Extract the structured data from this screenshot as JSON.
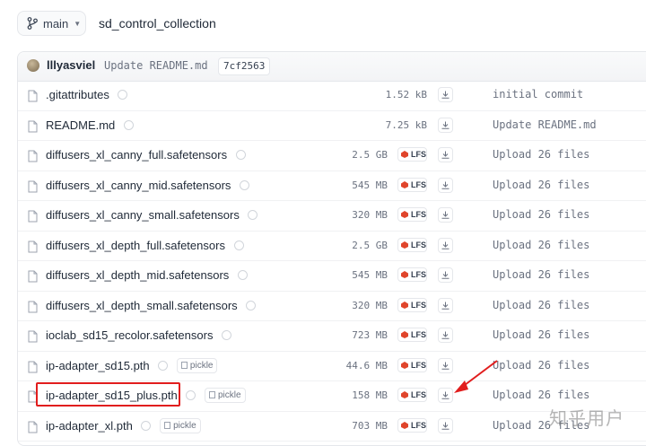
{
  "header": {
    "branch_label": "main",
    "repo_name": "sd_control_collection"
  },
  "commit": {
    "user": "lllyasviel",
    "message": "Update README.md",
    "hash": "7cf2563"
  },
  "files": [
    {
      "name": ".gitattributes",
      "size": "1.52 kB",
      "lfs": false,
      "pickle": false,
      "commit": "initial commit"
    },
    {
      "name": "README.md",
      "size": "7.25 kB",
      "lfs": false,
      "pickle": false,
      "commit": "Update README.md"
    },
    {
      "name": "diffusers_xl_canny_full.safetensors",
      "size": "2.5 GB",
      "lfs": true,
      "pickle": false,
      "commit": "Upload 26 files"
    },
    {
      "name": "diffusers_xl_canny_mid.safetensors",
      "size": "545 MB",
      "lfs": true,
      "pickle": false,
      "commit": "Upload 26 files"
    },
    {
      "name": "diffusers_xl_canny_small.safetensors",
      "size": "320 MB",
      "lfs": true,
      "pickle": false,
      "commit": "Upload 26 files"
    },
    {
      "name": "diffusers_xl_depth_full.safetensors",
      "size": "2.5 GB",
      "lfs": true,
      "pickle": false,
      "commit": "Upload 26 files"
    },
    {
      "name": "diffusers_xl_depth_mid.safetensors",
      "size": "545 MB",
      "lfs": true,
      "pickle": false,
      "commit": "Upload 26 files"
    },
    {
      "name": "diffusers_xl_depth_small.safetensors",
      "size": "320 MB",
      "lfs": true,
      "pickle": false,
      "commit": "Upload 26 files"
    },
    {
      "name": "ioclab_sd15_recolor.safetensors",
      "size": "723 MB",
      "lfs": true,
      "pickle": false,
      "commit": "Upload 26 files"
    },
    {
      "name": "ip-adapter_sd15.pth",
      "size": "44.6 MB",
      "lfs": true,
      "pickle": true,
      "commit": "Upload 26 files"
    },
    {
      "name": "ip-adapter_sd15_plus.pth",
      "size": "158 MB",
      "lfs": true,
      "pickle": true,
      "commit": "Upload 26 files"
    },
    {
      "name": "ip-adapter_xl.pth",
      "size": "703 MB",
      "lfs": true,
      "pickle": true,
      "commit": "Upload 26 files"
    }
  ],
  "badges": {
    "lfs_label": "LFS",
    "pickle_label": "pickle"
  },
  "watermark": "知乎用户",
  "colors": {
    "highlight": "#e11d1d",
    "lfs_gem": "#e0452b"
  },
  "icons": [
    "branch-icon",
    "chevron-down-icon",
    "file-icon",
    "info-icon",
    "lfs-gem-icon",
    "download-icon",
    "pickle-icon",
    "arrow-annotation"
  ]
}
